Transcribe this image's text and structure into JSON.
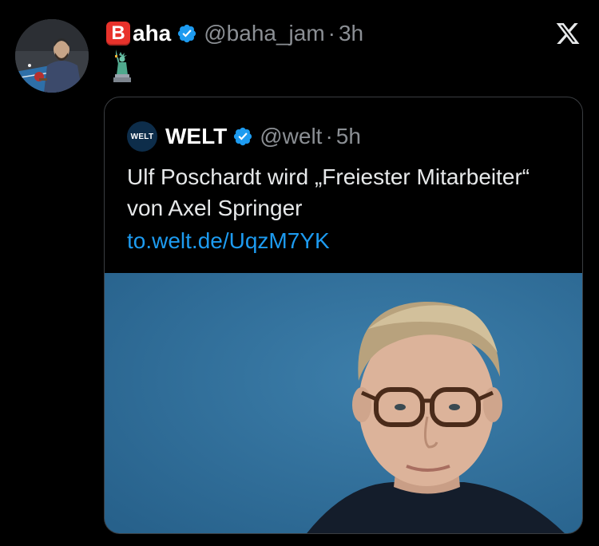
{
  "tweet": {
    "badge_letter": "B",
    "display_name": "aha",
    "handle": "@baha_jam",
    "separator": "·",
    "time": "3h",
    "body_emoji": "🗽"
  },
  "quote": {
    "avatar_text": "WELT",
    "display_name": "WELT",
    "handle": "@welt",
    "separator": "·",
    "time": "5h",
    "text": "Ulf Poschardt wird „Freiester Mitarbeiter“ von Axel Springer",
    "link": "to.welt.de/UqzM7YK"
  },
  "colors": {
    "background": "#000000",
    "verified": "#1d9bf0",
    "link": "#1d9bf0",
    "badge": "#e8322b",
    "image_background": "#316e9a"
  },
  "icons": {
    "verified": "verified-badge-icon",
    "x_logo": "x-logo-icon",
    "badge": "b-letter-emoji"
  }
}
